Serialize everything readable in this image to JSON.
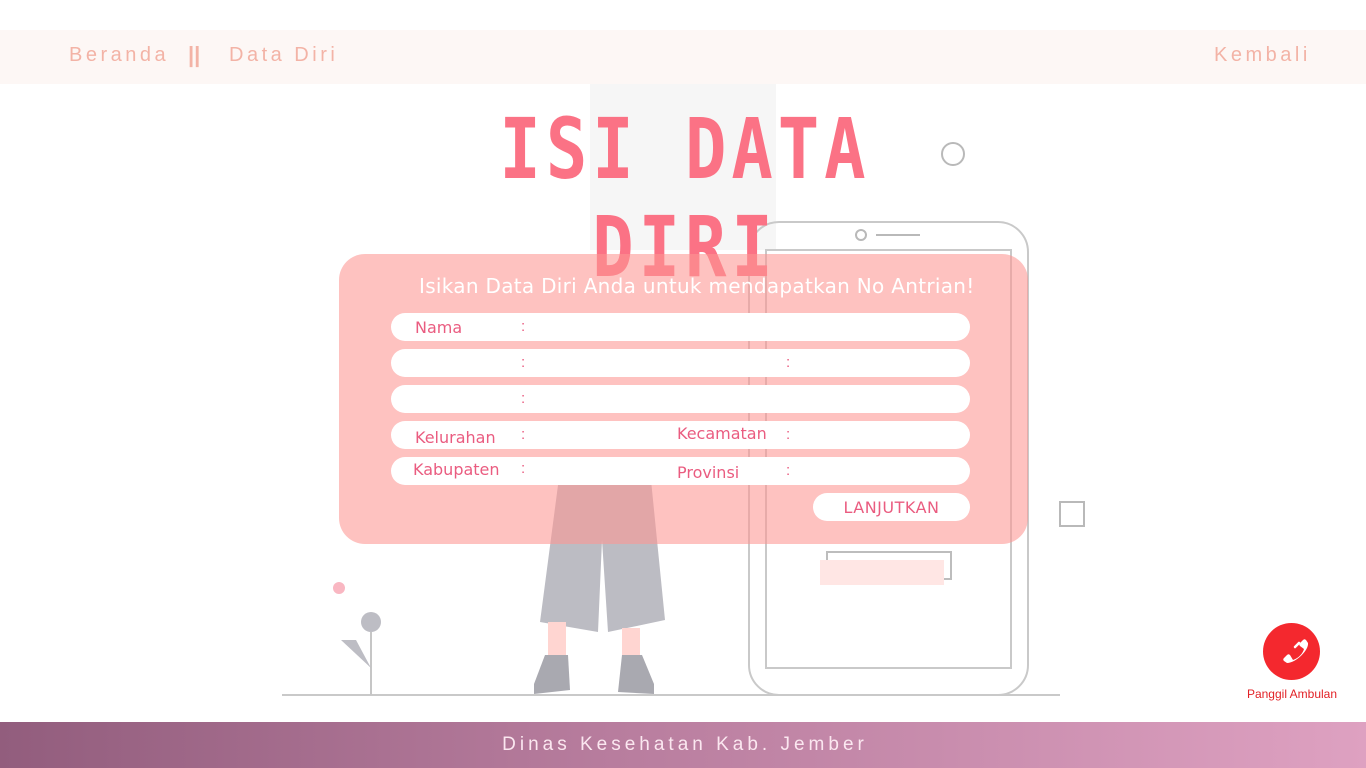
{
  "nav": {
    "home": "Beranda",
    "separator": "||",
    "current": "Data Diri",
    "back": "Kembali"
  },
  "title": "ISI DATA DIRI",
  "form": {
    "heading": "Isikan Data Diri Anda untuk mendapatkan No Antrian!",
    "fields": {
      "nama": {
        "label": "Nama",
        "value": ""
      },
      "row2_left": {
        "label": "",
        "value": ""
      },
      "row2_right": {
        "label": "",
        "value": ""
      },
      "row3": {
        "label": "",
        "value": ""
      },
      "kelurahan": {
        "label": "Kelurahan",
        "value": ""
      },
      "kecamatan": {
        "label": "Kecamatan",
        "value": ""
      },
      "kabupaten": {
        "label": "Kabupaten",
        "value": ""
      },
      "provinsi": {
        "label": "Provinsi",
        "value": ""
      }
    },
    "colon": ":",
    "submit": "LANJUTKAN"
  },
  "ambulance": {
    "icon": "phone-icon",
    "label": "Panggil Ambulan"
  },
  "footer": {
    "text": "Dinas Kesehatan Kab. Jember"
  },
  "colors": {
    "accent": "#fb7285",
    "nav_text": "#f3b3a6",
    "panel": "#fd9692",
    "ambulance": "#f4282e",
    "footer_start": "#925d7d",
    "footer_end": "#dea1c1"
  }
}
